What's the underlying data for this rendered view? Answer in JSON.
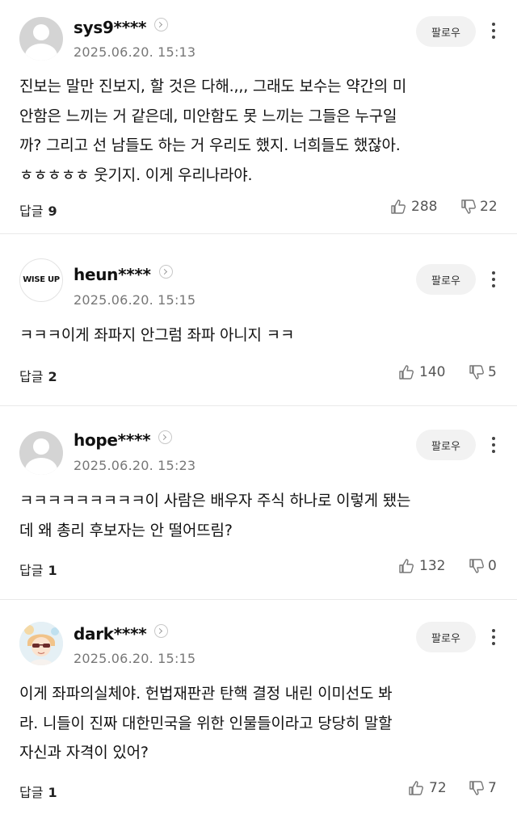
{
  "follow_label": "팔로우",
  "reply_label": "답글",
  "comments": [
    {
      "username": "sys9****",
      "date": "2025.06.20. 15:13",
      "avatar": "default-user-icon",
      "text": "진보는 말만 진보지, 할 것은 다해.,,, 그래도 보수는 약간의 미\n안함은 느끼는 거 같은데, 미안함도 못 느끼는 그들은 누구일\n까? 그리고 선 남들도 하는 거 우리도 했지. 너희들도 했잖아.\nㅎㅎㅎㅎㅎ 웃기지. 이게 우리나라야.",
      "replies": "9",
      "likes": "288",
      "dislikes": "22"
    },
    {
      "username": "heun****",
      "date": "2025.06.20. 15:15",
      "avatar": "wise-up-logo",
      "avatar_text": "WISE UP",
      "text": "ㅋㅋㅋ이게 좌파지 안그럼 좌파 아니지 ㅋㅋ",
      "replies": "2",
      "likes": "140",
      "dislikes": "5"
    },
    {
      "username": "hope****",
      "date": "2025.06.20. 15:23",
      "avatar": "default-user-icon",
      "text": "ㅋㅋㅋㅋㅋㅋㅋㅋㅋ이 사람은 배우자 주식 하나로 이렇게 됐는\n데 왜 총리 후보자는 안 떨어뜨림?",
      "replies": "1",
      "likes": "132",
      "dislikes": "0"
    },
    {
      "username": "dark****",
      "date": "2025.06.20. 15:15",
      "avatar": "character-illustration",
      "text": "이게 좌파의실체야. 헌법재판관 탄핵 결정 내린 이미선도 봐\n라. 니들이 진짜 대한민국을 위한 인물들이라고 당당히 말할\n자신과 자격이 있어?",
      "replies": "1",
      "likes": "72",
      "dislikes": "7"
    }
  ]
}
